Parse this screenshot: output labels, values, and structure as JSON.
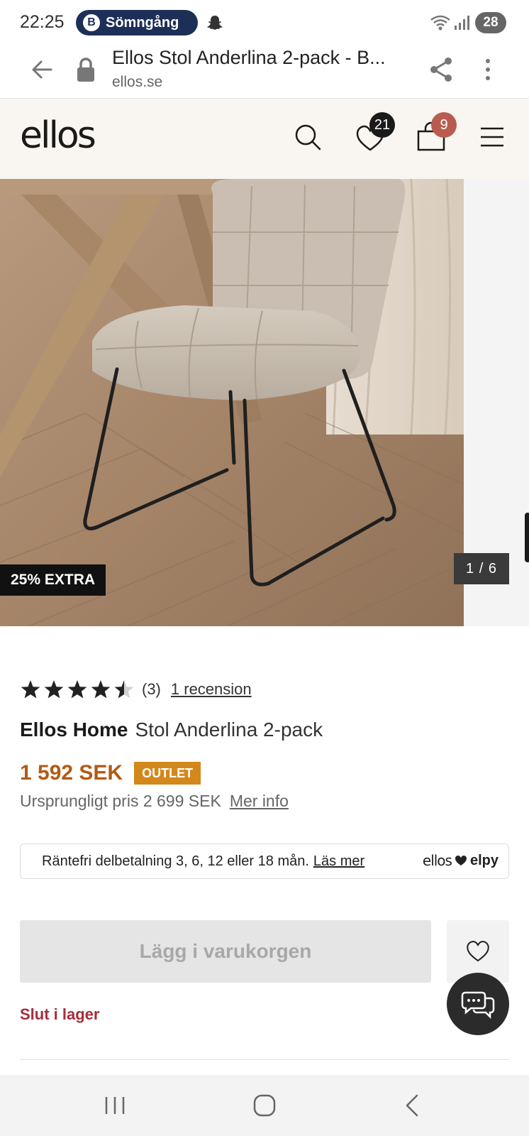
{
  "status_bar": {
    "time": "22:25",
    "notification_label": "Sömngång",
    "notification_icon": "B",
    "battery": "28",
    "icons": [
      "snapchat-icon",
      "wifi-icon",
      "signal-icon",
      "battery-icon"
    ]
  },
  "browser": {
    "page_title": "Ellos Stol Anderlina 2-pack - B...",
    "domain": "ellos.se"
  },
  "header": {
    "logo": "ellos",
    "wishlist_count": "21",
    "cart_count": "9",
    "accent_badge_color": "#b85c4f"
  },
  "gallery": {
    "promo_label": "25% EXTRA",
    "image_counter": "1 / 6"
  },
  "product": {
    "rating_value": 4.5,
    "rating_max": 5,
    "rating_count": "(3)",
    "review_link": "1 recension",
    "brand": "Ellos Home",
    "name": "Stol Anderlina 2-pack",
    "price": "1 592 SEK",
    "price_color": "#b35a14",
    "badge": "OUTLET",
    "original_price": "Ursprungligt pris 2 699 SEK",
    "more_info": "Mer info"
  },
  "financing": {
    "text": "Räntefri delbetalning 3, 6, 12 eller 18 mån.",
    "link": "Läs mer",
    "partner_left": "ellos",
    "partner_right": "elpy"
  },
  "actions": {
    "add_to_cart": "Lägg i varukorgen",
    "stock_status": "Slut i lager",
    "stock_color": "#a62d3b"
  }
}
